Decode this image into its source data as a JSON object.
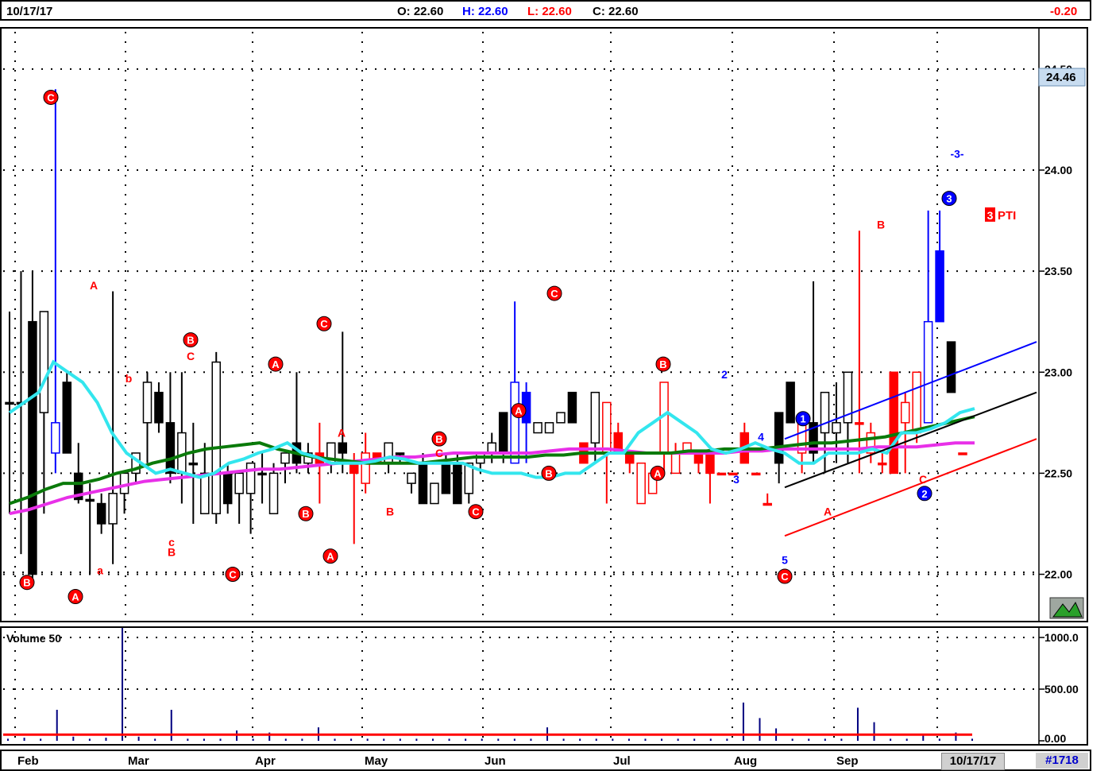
{
  "header": {
    "date": "10/17/17",
    "open_label": "O: 22.60",
    "high_label": "H: 22.60",
    "low_label": "L: 22.60",
    "close_label": "C: 22.60",
    "change": "-0.20"
  },
  "colors": {
    "up_blue": "#0000ff",
    "down_red": "#ff0000",
    "black": "#000000",
    "ma_cyan": "#33e6ee",
    "ma_green": "#0a7a0a",
    "ma_magenta": "#e830e8",
    "price_tag_bg": "#c8dcf0"
  },
  "price_tag": "24.46",
  "pti_badge": {
    "number": "3",
    "label": "PTI"
  },
  "volume_panel": {
    "title": "Volume 50",
    "ticks": [
      "1000.0",
      "500.00",
      "0.00"
    ]
  },
  "footer": {
    "months": [
      "Feb",
      "Mar",
      "Apr",
      "May",
      "Jun",
      "Jul",
      "Aug",
      "Sep"
    ],
    "current_date": "10/17/17",
    "count": "#1718"
  },
  "chart_data": {
    "type": "candlestick",
    "y_ticks": [
      "22.00",
      "22.50",
      "23.00",
      "23.50",
      "24.00",
      "24.50"
    ],
    "ylim": [
      21.77,
      24.7
    ],
    "grid": true,
    "candles": [
      [
        22.85,
        22.3,
        23.3,
        22.85,
        "b"
      ],
      [
        22.85,
        22.1,
        23.5,
        22.85,
        "b"
      ],
      [
        23.25,
        21.95,
        23.5,
        22.0,
        "b"
      ],
      [
        22.8,
        22.3,
        23.3,
        23.3,
        "w"
      ],
      [
        22.6,
        22.5,
        24.4,
        22.75,
        "blue"
      ],
      [
        22.95,
        22.6,
        23.0,
        22.6,
        "b"
      ],
      [
        22.5,
        22.35,
        22.65,
        22.37,
        "b"
      ],
      [
        22.37,
        22.0,
        22.45,
        22.37,
        "b"
      ],
      [
        22.35,
        22.2,
        22.4,
        22.25,
        "b"
      ],
      [
        22.25,
        22.05,
        23.4,
        22.4,
        "w"
      ],
      [
        22.4,
        22.3,
        22.5,
        22.5,
        "w"
      ],
      [
        22.5,
        22.45,
        22.6,
        22.6,
        "w"
      ],
      [
        22.75,
        22.55,
        23.0,
        22.95,
        "w"
      ],
      [
        22.9,
        22.7,
        22.95,
        22.75,
        "b"
      ],
      [
        22.75,
        22.45,
        23.0,
        22.5,
        "b"
      ],
      [
        22.5,
        22.35,
        23.0,
        22.7,
        "w"
      ],
      [
        22.55,
        22.25,
        22.75,
        22.55,
        "b"
      ],
      [
        22.5,
        22.3,
        22.65,
        22.3,
        "w"
      ],
      [
        22.3,
        22.25,
        23.1,
        23.05,
        "w"
      ],
      [
        22.5,
        22.3,
        22.55,
        22.35,
        "b"
      ],
      [
        22.4,
        22.25,
        22.5,
        22.5,
        "w"
      ],
      [
        22.55,
        22.2,
        22.55,
        22.4,
        "w"
      ],
      [
        22.5,
        22.35,
        22.6,
        22.5,
        "b"
      ],
      [
        22.5,
        22.3,
        22.55,
        22.3,
        "w"
      ],
      [
        22.55,
        22.45,
        22.6,
        22.6,
        "w"
      ],
      [
        22.65,
        22.5,
        23.0,
        22.55,
        "b"
      ],
      [
        22.55,
        22.5,
        22.65,
        22.6,
        "w"
      ],
      [
        22.6,
        22.35,
        22.75,
        22.55,
        "r"
      ],
      [
        22.55,
        22.5,
        22.65,
        22.65,
        "w"
      ],
      [
        22.6,
        22.5,
        23.2,
        22.65,
        "b"
      ],
      [
        22.55,
        22.15,
        22.6,
        22.5,
        "r"
      ],
      [
        22.45,
        22.4,
        22.7,
        22.6,
        "ro"
      ],
      [
        22.6,
        22.55,
        22.6,
        22.55,
        "r"
      ],
      [
        22.55,
        22.5,
        22.65,
        22.65,
        "w"
      ],
      [
        22.6,
        22.55,
        22.6,
        22.6,
        "b"
      ],
      [
        22.45,
        22.4,
        22.5,
        22.5,
        "w"
      ],
      [
        22.55,
        22.35,
        22.6,
        22.35,
        "b"
      ],
      [
        22.35,
        22.35,
        22.45,
        22.45,
        "w"
      ],
      [
        22.55,
        22.4,
        22.6,
        22.4,
        "b"
      ],
      [
        22.55,
        22.35,
        22.6,
        22.35,
        "b"
      ],
      [
        22.4,
        22.35,
        22.55,
        22.55,
        "w"
      ],
      [
        22.55,
        22.5,
        22.6,
        22.6,
        "w"
      ],
      [
        22.6,
        22.55,
        22.7,
        22.65,
        "w"
      ],
      [
        22.6,
        22.55,
        22.8,
        22.8,
        "b"
      ],
      [
        22.55,
        22.55,
        23.35,
        22.95,
        "blue"
      ],
      [
        22.9,
        22.55,
        22.95,
        22.75,
        "blue"
      ],
      [
        22.7,
        22.7,
        22.75,
        22.75,
        "w"
      ],
      [
        22.7,
        22.7,
        22.75,
        22.75,
        "w"
      ],
      [
        22.75,
        22.75,
        22.8,
        22.8,
        "w"
      ],
      [
        22.75,
        22.75,
        22.9,
        22.9,
        "b"
      ],
      [
        22.65,
        22.55,
        22.65,
        22.55,
        "r"
      ],
      [
        22.65,
        22.55,
        22.9,
        22.9,
        "w"
      ],
      [
        22.85,
        22.35,
        22.85,
        22.6,
        "ro"
      ],
      [
        22.7,
        22.6,
        22.75,
        22.6,
        "r"
      ],
      [
        22.6,
        22.5,
        22.6,
        22.55,
        "r"
      ],
      [
        22.55,
        22.35,
        22.55,
        22.35,
        "ro"
      ],
      [
        22.4,
        22.4,
        22.5,
        22.5,
        "ro"
      ],
      [
        22.6,
        22.5,
        22.95,
        22.95,
        "ro"
      ],
      [
        22.6,
        22.5,
        22.65,
        22.5,
        "ro"
      ],
      [
        22.6,
        22.6,
        22.65,
        22.65,
        "ro"
      ],
      [
        22.6,
        22.5,
        22.6,
        22.55,
        "r"
      ],
      [
        22.6,
        22.35,
        22.6,
        22.5,
        "r"
      ],
      [
        22.5,
        22.5,
        22.5,
        22.5,
        "r"
      ],
      [
        22.5,
        22.5,
        22.5,
        22.5,
        "r"
      ],
      [
        22.7,
        22.55,
        22.75,
        22.55,
        "r"
      ],
      [
        22.5,
        22.5,
        22.5,
        22.5,
        "r"
      ],
      [
        22.35,
        22.35,
        22.4,
        22.35,
        "r"
      ],
      [
        22.55,
        22.45,
        22.8,
        22.8,
        "b"
      ],
      [
        22.95,
        22.75,
        22.95,
        22.75,
        "b"
      ],
      [
        22.75,
        22.5,
        22.8,
        22.6,
        "ro"
      ],
      [
        22.75,
        22.55,
        23.45,
        22.6,
        "b"
      ],
      [
        22.7,
        22.5,
        22.9,
        22.9,
        "w"
      ],
      [
        22.75,
        22.55,
        22.95,
        22.7,
        "w"
      ],
      [
        22.75,
        22.55,
        23.0,
        23.0,
        "w"
      ],
      [
        22.75,
        22.5,
        23.7,
        22.75,
        "r"
      ],
      [
        22.7,
        22.55,
        22.75,
        22.6,
        "ro"
      ],
      [
        22.55,
        22.5,
        22.6,
        22.55,
        "r"
      ],
      [
        23.0,
        22.5,
        23.0,
        22.5,
        "r"
      ],
      [
        22.85,
        22.5,
        22.9,
        22.75,
        "ro"
      ],
      [
        23.0,
        22.65,
        23.0,
        22.7,
        "ro"
      ],
      [
        22.75,
        22.75,
        23.8,
        23.25,
        "blue"
      ],
      [
        23.6,
        23.25,
        23.8,
        23.25,
        "blue"
      ],
      [
        23.15,
        22.9,
        23.15,
        22.9,
        "b"
      ],
      [
        22.6,
        22.6,
        22.6,
        22.6,
        "r"
      ]
    ],
    "moving_averages": {
      "cyan": [
        22.8,
        22.85,
        22.9,
        23.05,
        23.0,
        22.95,
        22.85,
        22.7,
        22.6,
        22.55,
        22.5,
        22.52,
        22.5,
        22.48,
        22.5,
        22.55,
        22.57,
        22.6,
        22.62,
        22.65,
        22.6,
        22.58,
        22.55,
        22.55,
        22.55,
        22.56,
        22.58,
        22.57,
        22.55,
        22.55,
        22.55,
        22.55,
        22.52,
        22.5,
        22.5,
        22.5,
        22.48,
        22.48,
        22.5,
        22.5,
        22.55,
        22.6,
        22.6,
        22.7,
        22.75,
        22.8,
        22.75,
        22.7,
        22.62,
        22.6,
        22.62,
        22.65,
        22.62,
        22.6,
        22.55,
        22.55,
        22.6,
        22.6,
        22.6,
        22.62,
        22.6,
        22.7,
        22.7,
        22.72,
        22.75,
        22.8,
        22.82
      ],
      "green": [
        22.35,
        22.38,
        22.42,
        22.45,
        22.45,
        22.47,
        22.5,
        22.52,
        22.55,
        22.57,
        22.6,
        22.62,
        22.63,
        22.64,
        22.65,
        22.62,
        22.6,
        22.58,
        22.57,
        22.56,
        22.55,
        22.55,
        22.55,
        22.55,
        22.56,
        22.57,
        22.58,
        22.58,
        22.58,
        22.58,
        22.59,
        22.59,
        22.6,
        22.6,
        22.6,
        22.6,
        22.6,
        22.6,
        22.61,
        22.61,
        22.62,
        22.62,
        22.62,
        22.63,
        22.64,
        22.65,
        22.65,
        22.66,
        22.67,
        22.68,
        22.7,
        22.72,
        22.74,
        22.76,
        22.78
      ],
      "magenta": [
        22.3,
        22.32,
        22.35,
        22.38,
        22.4,
        22.42,
        22.44,
        22.46,
        22.47,
        22.48,
        22.49,
        22.5,
        22.51,
        22.52,
        22.52,
        22.53,
        22.54,
        22.55,
        22.56,
        22.57,
        22.58,
        22.58,
        22.59,
        22.6,
        22.6,
        22.6,
        22.6,
        22.6,
        22.61,
        22.62,
        22.62,
        22.62,
        22.61,
        22.6,
        22.6,
        22.6,
        22.6,
        22.6,
        22.61,
        22.61,
        22.62,
        22.62,
        22.62,
        22.62,
        22.62,
        22.63,
        22.63,
        22.63,
        22.64,
        22.65,
        22.65
      ]
    },
    "trendlines": [
      {
        "color": "blue",
        "from": [
          0.0,
          22.67
        ],
        "to": [
          1.0,
          23.15
        ]
      },
      {
        "color": "black",
        "from": [
          0.0,
          22.43
        ],
        "to": [
          1.0,
          22.9
        ]
      },
      {
        "color": "red",
        "from": [
          0.0,
          22.19
        ],
        "to": [
          1.0,
          22.67
        ]
      }
    ],
    "wave_labels": [
      {
        "text": "C",
        "style": "circle",
        "color": "red",
        "price": 24.36
      },
      {
        "text": "B",
        "style": "circle",
        "color": "red",
        "price": 21.96
      },
      {
        "text": "A",
        "style": "circle",
        "color": "red",
        "price": 21.89
      },
      {
        "text": "A",
        "style": "plain",
        "color": "red",
        "price": 23.43
      },
      {
        "text": "b",
        "style": "plain",
        "color": "red",
        "price": 22.97
      },
      {
        "text": "a",
        "style": "plain",
        "color": "red",
        "price": 22.02
      },
      {
        "text": "c",
        "style": "plain",
        "color": "red",
        "price": 22.16
      },
      {
        "text": "B",
        "style": "plain",
        "color": "red",
        "price": 22.11
      },
      {
        "text": "B",
        "style": "circle",
        "color": "red",
        "price": 23.16
      },
      {
        "text": "C",
        "style": "plain",
        "color": "red",
        "price": 23.08
      },
      {
        "text": "C",
        "style": "circle",
        "color": "red",
        "price": 22.0
      },
      {
        "text": "A",
        "style": "circle",
        "color": "red",
        "price": 23.04
      },
      {
        "text": "B",
        "style": "circle",
        "color": "red",
        "price": 22.3
      },
      {
        "text": "C",
        "style": "circle",
        "color": "red",
        "price": 23.24
      },
      {
        "text": "A",
        "style": "plain",
        "color": "red",
        "price": 22.7
      },
      {
        "text": "A",
        "style": "circle",
        "color": "red",
        "price": 22.09
      },
      {
        "text": "B",
        "style": "plain",
        "color": "red",
        "price": 22.31
      },
      {
        "text": "B",
        "style": "circle",
        "color": "red",
        "price": 22.67
      },
      {
        "text": "C",
        "style": "plain",
        "color": "red",
        "price": 22.6
      },
      {
        "text": "C",
        "style": "circle",
        "color": "red",
        "price": 22.31
      },
      {
        "text": "A",
        "style": "circle",
        "color": "red",
        "price": 22.81
      },
      {
        "text": "B",
        "style": "circle",
        "color": "red",
        "price": 22.5
      },
      {
        "text": "C",
        "style": "circle",
        "color": "red",
        "price": 23.39
      },
      {
        "text": "B",
        "style": "circle",
        "color": "red",
        "price": 23.04
      },
      {
        "text": "A",
        "style": "circle",
        "color": "red",
        "price": 22.5
      },
      {
        "text": "2",
        "style": "plain",
        "color": "blue",
        "price": 22.99
      },
      {
        "text": "3",
        "style": "plain",
        "color": "blue",
        "price": 22.47
      },
      {
        "text": "4",
        "style": "plain",
        "color": "blue",
        "price": 22.68
      },
      {
        "text": "1",
        "style": "circle",
        "color": "blue",
        "price": 22.77
      },
      {
        "text": "5",
        "style": "plain",
        "color": "blue",
        "price": 22.07
      },
      {
        "text": "C",
        "style": "circle",
        "color": "red",
        "price": 21.99
      },
      {
        "text": "A",
        "style": "plain",
        "color": "red",
        "price": 22.31
      },
      {
        "text": "B",
        "style": "plain",
        "color": "red",
        "price": 23.73
      },
      {
        "text": "C",
        "style": "plain",
        "color": "red",
        "price": 22.47
      },
      {
        "text": "2",
        "style": "circle",
        "color": "blue",
        "price": 22.4
      },
      {
        "text": "3",
        "style": "circle",
        "color": "blue",
        "price": 23.86
      },
      {
        "text": "-3-",
        "style": "plain",
        "color": "blue",
        "price": 24.08
      }
    ],
    "volume": {
      "ylim": [
        0,
        1000
      ],
      "bars": [
        20,
        30,
        20,
        300,
        40,
        20,
        30,
        1700,
        40,
        20,
        300,
        20,
        20,
        20,
        100,
        20,
        80,
        20,
        20,
        130,
        20,
        20,
        20,
        20,
        20,
        20,
        20,
        20,
        20,
        20,
        20,
        20,
        20,
        130,
        20,
        20,
        20,
        20,
        20,
        20,
        20,
        20,
        20,
        20,
        20,
        370,
        220,
        120,
        20,
        20,
        20,
        20,
        320,
        180,
        20,
        20,
        50,
        20,
        80,
        20
      ],
      "baseline_red": 60
    }
  }
}
